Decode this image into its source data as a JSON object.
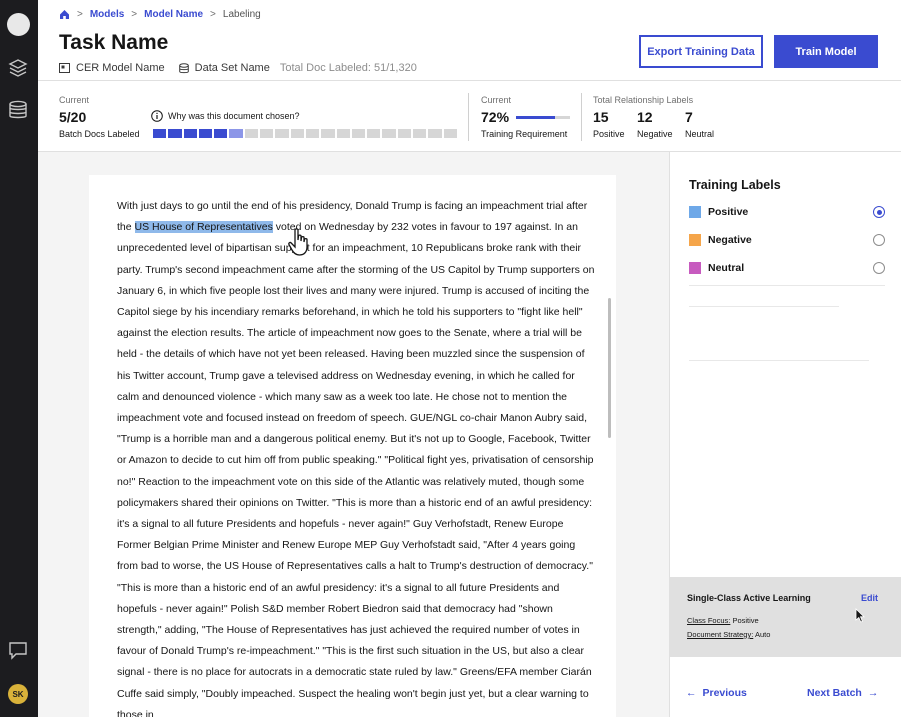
{
  "sidebar": {
    "avatar_initials": "SK",
    "icons": [
      "layers-icon",
      "database-icon",
      "chat-icon"
    ]
  },
  "breadcrumb": {
    "home_icon": "home-icon",
    "items": [
      "Models",
      "Model Name",
      "Labeling"
    ]
  },
  "header": {
    "title": "Task Name",
    "model_name": "CER Model Name",
    "data_set_name": "Data Set Name",
    "total_doc_labeled": "Total Doc Labeled: 51/1,320",
    "export_button": "Export Training Data",
    "train_button": "Train Model",
    "accent_color": "#3a4bd0"
  },
  "stats": {
    "batch": {
      "label": "Current",
      "value": "5/20",
      "sublabel": "Batch Docs Labeled"
    },
    "why_text": "Why was this document chosen?",
    "batch_progress": {
      "segments_total": 20,
      "segments_complete": 5,
      "segment_partial": 1
    },
    "training": {
      "label": "Current",
      "value": "72%",
      "progress": 0.72,
      "sublabel": "Training Requirement"
    },
    "relationships": {
      "label": "Total Relationship Labels",
      "positive": {
        "value": "15",
        "label": "Positive"
      },
      "negative": {
        "value": "12",
        "label": "Negative"
      },
      "neutral": {
        "value": "7",
        "label": "Neutral"
      }
    }
  },
  "document": {
    "text_before": "With just days to go until the end of his presidency, Donald Trump is facing an impeachment trial after the ",
    "highlight": "US House of Representatives",
    "text_after": " voted on Wednesday by 232 votes in favour to 197 against. In an unprecedented level of bipartisan support for an impeachment, 10 Republicans broke rank with their party. Trump's second impeachment came after the storming of the US Capitol by Trump supporters on January 6, in which five people lost their lives and many were injured. Trump is accused of inciting the Capitol siege by his incendiary remarks beforehand, in which he told his supporters to \"fight like hell\" against the election results. The article of impeachment now goes to the Senate, where a trial will be held - the details of which have not yet been released. Having been muzzled since the suspension of his Twitter account, Trump gave a televised address on Wednesday evening, in which he called for calm and denounced violence - which many saw as a week too late. He chose not to mention the impeachment vote and focused instead on freedom of speech. GUE/NGL co-chair Manon Aubry said, \"Trump is a horrible man and a dangerous political enemy. But it's not up to Google, Facebook, Twitter or Amazon to decide to cut him off from public speaking.\" \"Political fight yes, privatisation of censorship no!\" Reaction to the impeachment vote on this side of the Atlantic was relatively muted, though some policymakers shared their opinions on Twitter. \"This is more than a historic end of an awful presidency: it's a signal to all future Presidents and hopefuls - never again!\" Guy Verhofstadt, Renew Europe Former Belgian Prime Minister and Renew Europe MEP Guy Verhofstadt said, \"After 4 years going from bad to worse, the US House of Representatives calls a halt to Trump's destruction of democracy.\" \"This is more than a historic end of an awful presidency: it's a signal to all future Presidents and hopefuls - never again!\" Polish S&D member Robert Biedron said that democracy had \"shown strength,\" adding, \"The House of Representatives has just achieved the required number of votes in favour of Donald Trump's re-impeachment.\" \"This is the first such situation in the US, but also a clear signal - there is no place for autocrats in a democratic state ruled by law.\" Greens/EFA member Ciarán Cuffe said simply, \"Doubly impeached. Suspect the healing won't begin just yet, but a clear warning to those in"
  },
  "panel": {
    "title": "Training  Labels",
    "labels": [
      {
        "name": "Positive",
        "color": "#6ea8e8",
        "selected": true
      },
      {
        "name": "Negative",
        "color": "#f5a54a",
        "selected": false
      },
      {
        "name": "Neutral",
        "color": "#c75bbf",
        "selected": false
      }
    ],
    "active_learning": {
      "title": "Single-Class Active Learning",
      "edit": "Edit",
      "class_focus_label": "Class Focus:",
      "class_focus_value": "Positive",
      "doc_strategy_label": "Document Strategy:",
      "doc_strategy_value": "Auto"
    },
    "previous": "Previous",
    "next": "Next Batch"
  }
}
